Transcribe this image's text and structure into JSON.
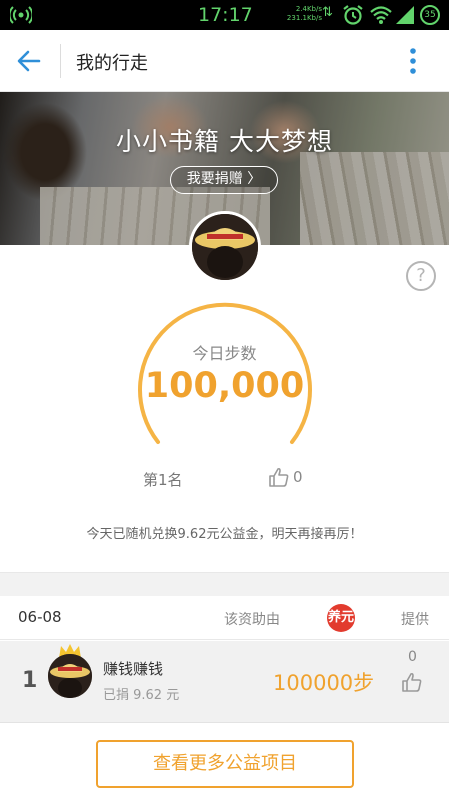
{
  "status_bar": {
    "time": "17:17",
    "net_up": "2.4Kb/s",
    "net_down": "231.1Kb/s",
    "battery": "35",
    "accent": "#62d46c"
  },
  "app_bar": {
    "title": "我的行走"
  },
  "banner": {
    "headline": "小小书籍 大大梦想",
    "donate_label": "我要捐赠 〉"
  },
  "gauge": {
    "label": "今日步数",
    "value": "100,000",
    "accent": "#f0a22e"
  },
  "rank": "第1名",
  "likes": "0",
  "note": "今天已随机兑换9.62元公益金，明天再接再厉！",
  "table": {
    "date": "06-08",
    "sponsor_label": "该资助由",
    "sponsor_logo_text": "养元",
    "provide_label": "提供",
    "rows": [
      {
        "rank": "1",
        "name": "赚钱赚钱",
        "donated": "已捐 9.62 元",
        "steps": "100000步",
        "likes": "0"
      }
    ]
  },
  "footer_button": "查看更多公益项目"
}
